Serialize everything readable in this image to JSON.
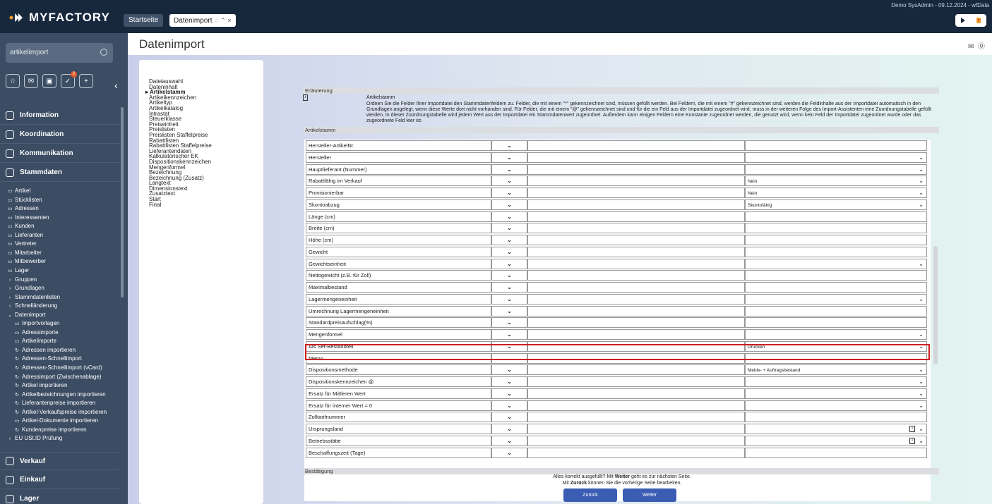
{
  "app": {
    "brand": "MYFACTORY",
    "user_info": "Demo SysAdmin - 09.12.2024 - wfData"
  },
  "tabs": [
    {
      "label": "Startseite"
    },
    {
      "label": "Datenimport",
      "controls": "◌ ⌃ ×"
    }
  ],
  "sidebar": {
    "search_value": "artikelimport",
    "sections_top": [
      {
        "label": "Information"
      },
      {
        "label": "Koordination"
      },
      {
        "label": "Kommunikation"
      },
      {
        "label": "Stammdaten"
      }
    ],
    "items": [
      {
        "label": "Artikel",
        "icon": "▭"
      },
      {
        "label": "Stücklisten",
        "icon": "▭"
      },
      {
        "label": "Adressen",
        "icon": "▭"
      },
      {
        "label": "Interessenten",
        "icon": "▭"
      },
      {
        "label": "Kunden",
        "icon": "▭"
      },
      {
        "label": "Lieferanten",
        "icon": "▭"
      },
      {
        "label": "Vertreter",
        "icon": "▭"
      },
      {
        "label": "Mitarbeiter",
        "icon": "▭"
      },
      {
        "label": "Mitbewerber",
        "icon": "▭"
      },
      {
        "label": "Lager",
        "icon": "▭"
      },
      {
        "label": "Gruppen",
        "icon": "›"
      },
      {
        "label": "Grundlagen",
        "icon": "›"
      },
      {
        "label": "Stammdatenlisten",
        "icon": "›"
      },
      {
        "label": "Schnelländerung",
        "icon": "›"
      },
      {
        "label": "Datenimport",
        "icon": "⌄"
      }
    ],
    "subitems": [
      {
        "label": "Importvorlagen",
        "icon": "▭"
      },
      {
        "label": "Adressimporte",
        "icon": "▭"
      },
      {
        "label": "Artikelimporte",
        "icon": "▭"
      },
      {
        "label": "Adressen importieren",
        "icon": "↻"
      },
      {
        "label": "Adressen-Schnellimport",
        "icon": "↻"
      },
      {
        "label": "Adressen-Schnellimport (vCard)",
        "icon": "↻"
      },
      {
        "label": "Adressimport (Zwischenablage)",
        "icon": "↻"
      },
      {
        "label": "Artikel importieren",
        "icon": "↻"
      },
      {
        "label": "Artikelbezeichnungen importieren",
        "icon": "↻"
      },
      {
        "label": "Lieferantenpreise importieren",
        "icon": "↻"
      },
      {
        "label": "Artikel-Verkaufspreise importieren",
        "icon": "↻"
      },
      {
        "label": "Artikel-Dokumente importieren",
        "icon": "▭"
      },
      {
        "label": "Kundenpreise importieren",
        "icon": "↻"
      }
    ],
    "eu_item": {
      "label": "EU USt.ID Prüfung",
      "icon": "›"
    },
    "sections_bottom": [
      {
        "label": "Verkauf"
      },
      {
        "label": "Einkauf"
      },
      {
        "label": "Lager"
      }
    ],
    "badge_count": "2"
  },
  "page": {
    "title": "Datenimport"
  },
  "steps": [
    "Dateiauswahl",
    "Dateninhalt",
    "Artikelstamm",
    "Artikelkennzeichen",
    "Artikeltyp",
    "Artikelkatalog",
    "Intrastat",
    "Steuerklasse",
    "Preiseinheit",
    "Preislisten",
    "Preislisten Staffelpreise",
    "Rabattlisten",
    "Rabattlisten Staffelpreise",
    "Lieferantendaten",
    "Kalkulatorischer EK",
    "Dispositionskennzeichen",
    "Mengenformel",
    "Bezeichnung",
    "Bezeichnung (Zusatz)",
    "Langtext",
    "Dimensionstext",
    "Zusatztext",
    "Start",
    "Final"
  ],
  "active_step": "Artikelstamm",
  "erlaeuterung": {
    "header": "Erläuterung",
    "title": "Artikelstamm",
    "text": "Ordnen Sie die Felder Ihrer Importdatei den Stammdatenfeldern zu. Felder, die mit einem \"*\" gekennzeichnet sind, müssen gefüllt werden. Bei Feldern, die mit einem \"#\" gekennzeichnet sind, werden die Feldinhalte aus der Importdatei automatisch in den Grundlagen angelegt, wenn diese Werte dort nicht vorhanden sind. Für Felder, die mit einem \"@\" gekennzeichnet sind und für die ein Feld aus der Importdatei zugeordnet wird, muss in der weiteren Folge des Import-Assistenten eine Zuordnungstabelle gefüllt werden. In dieser Zuordnungstabelle wird jedem Wert aus der Importdatei ein Stammdatenwert zugeordnet. Außerdem kann einigen Feldern eine Konstante zugeordnet werden, die genutzt wird, wenn kein Feld der Importdatei zugeordnet wurde oder das zugeordnete Feld leer ist."
  },
  "artikelstamm_header": "Artikelstamm",
  "rows": [
    {
      "field": "Hersteller-ArtikelNr.",
      "const": "",
      "const_dd": false
    },
    {
      "field": "Hersteller",
      "const": "",
      "const_dd": true
    },
    {
      "field": "Hauptlieferant (Nummer)",
      "const": "",
      "const_dd": true
    },
    {
      "field": "Rabattfähig im Verkauf",
      "const": "Nein",
      "const_dd": true
    },
    {
      "field": "Provisionierbar",
      "const": "Nein",
      "const_dd": true
    },
    {
      "field": "Skontoabzug",
      "const": "Skontofähig",
      "const_dd": true
    },
    {
      "field": "Länge (cm)",
      "const": "",
      "const_dd": false
    },
    {
      "field": "Breite (cm)",
      "const": "",
      "const_dd": false
    },
    {
      "field": "Höhe (cm)",
      "const": "",
      "const_dd": false
    },
    {
      "field": "Gewicht",
      "const": "",
      "const_dd": false
    },
    {
      "field": "Gewichtseinheit",
      "const": "",
      "const_dd": true
    },
    {
      "field": "Nettogewicht (z.B. für Zoll)",
      "const": "",
      "const_dd": false
    },
    {
      "field": "Maximalbestand",
      "const": "",
      "const_dd": false
    },
    {
      "field": "Lagermengeneinheit",
      "const": "",
      "const_dd": true
    },
    {
      "field": "Umrechnung Lagermengeneinheit",
      "const": "",
      "const_dd": false
    },
    {
      "field": "Standardpreisaufschlag(%)",
      "const": "",
      "const_dd": false
    },
    {
      "field": "Mengenformel",
      "const": "",
      "const_dd": true
    },
    {
      "field": "Als Set-Bestandteil",
      "const": "Drucken",
      "const_dd": true
    },
    {
      "field": "Memo",
      "const": "",
      "const_dd": false
    },
    {
      "field": "Dispositionsmethode",
      "const": "Melde- + Auftragsbestand",
      "const_dd": true
    },
    {
      "field": "Dispositionskennzeichen @",
      "const": "",
      "const_dd": true
    },
    {
      "field": "Ersatz für Mittleren Wert",
      "const": "",
      "const_dd": true
    },
    {
      "field": "Ersatz für interner Wert = 0",
      "const": "",
      "const_dd": true
    },
    {
      "field": "Zolltarifnummer",
      "const": "",
      "const_dd": false
    },
    {
      "field": "Ursprungsland",
      "const": "",
      "const_dd": true,
      "info": true
    },
    {
      "field": "Betriebsstätte",
      "const": "",
      "const_dd": true,
      "info": true
    },
    {
      "field": "Beschaffungszeit (Tage)",
      "const": "",
      "const_dd": false
    }
  ],
  "bestaetigung": {
    "header": "Bestätigung",
    "line1_pre": "Alles korrekt ausgefüllt?  Mit ",
    "line1_bold": "Weiter",
    "line1_post": " geht es zur nächsten Seite.",
    "line2_pre": "Mit ",
    "line2_bold": "Zurück",
    "line2_post": " können Sie die vorherige Seite bearbeiten.",
    "back_label": "Zurück",
    "next_label": "Weiter"
  },
  "colors": {
    "topbar": "#17283d",
    "sidebar": "#3b4c63",
    "primary_button": "#3a5db3",
    "highlight": "#cc1f1f"
  }
}
